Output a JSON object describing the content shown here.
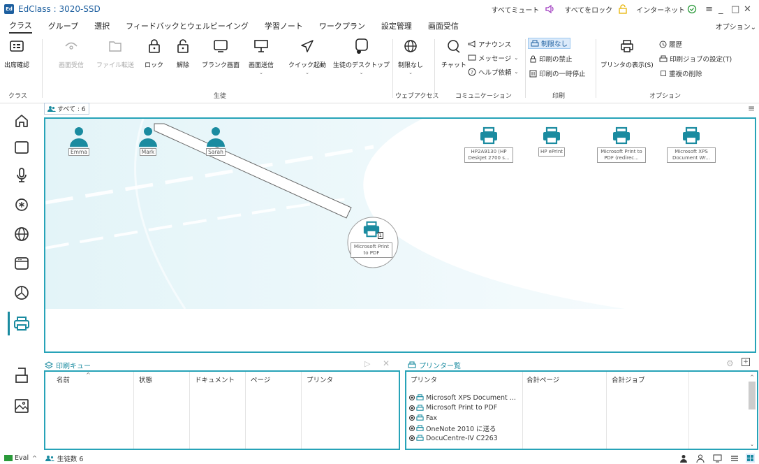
{
  "app": {
    "title": "EdClass : 3020-SSD",
    "logo": "Ed"
  },
  "titlebar": {
    "mute_all": "すべてミュート",
    "lock_all": "すべてをロック",
    "internet": "インターネット",
    "minimize": "_",
    "maximize": "□",
    "close": "✕"
  },
  "menu": {
    "tabs": [
      "クラス",
      "グループ",
      "選択",
      "フィードバックとウェルビーイング",
      "学習ノート",
      "ワークプラン",
      "設定管理",
      "画面受信"
    ],
    "options": "オプション"
  },
  "ribbon": {
    "attendance": "出席確認",
    "screen_receive": "画面受信",
    "file_transfer": "ファイル転送",
    "lock": "ロック",
    "unlock": "解除",
    "blank_screen": "ブランク画面",
    "screen_send": "画面送信",
    "quick_launch": "クイック起動",
    "student_desktop": "生徒のデスクトップ",
    "no_limit_web": "制限なし",
    "chat": "チャット",
    "announce": "アナウンス",
    "message": "メッセージ",
    "help_request": "ヘルプ依頼",
    "print_no_limit": "制限なし",
    "print_prohibit": "印刷の禁止",
    "print_pause": "印刷の一時停止",
    "show_printer": "プリンタの表示(S)",
    "history": "履歴",
    "print_job_settings": "印刷ジョブの設定(T)",
    "remove_duplicates": "重複の削除",
    "groups": {
      "class": "クラス",
      "student": "生徒",
      "web_access": "ウェブアクセス",
      "communication": "コミュニケーション",
      "print": "印刷",
      "options": "オプション"
    }
  },
  "breadcrumb": {
    "label": "すべて : 6"
  },
  "students": [
    {
      "name": "Emma"
    },
    {
      "name": "Mark"
    },
    {
      "name": "Sarah"
    }
  ],
  "printers": [
    {
      "name": "HP2A9130 (HP DeskJet 2700 s..."
    },
    {
      "name": "HP ePrint"
    },
    {
      "name": "Microsoft Print to PDF (redirec..."
    },
    {
      "name": "Microsoft XPS Document Wr..."
    }
  ],
  "selected_printer": {
    "name": "Microsoft Print to PDF",
    "badge": "1"
  },
  "print_queue": {
    "title": "印刷キュー",
    "columns": [
      "名前",
      "状態",
      "ドキュメント",
      "ページ",
      "プリンタ"
    ]
  },
  "printer_list": {
    "title": "プリンター覧",
    "columns": [
      "プリンタ",
      "合計ページ",
      "合計ジョブ"
    ],
    "rows": [
      "Microsoft XPS Document ...",
      "Microsoft Print to PDF",
      "Fax",
      "OneNote 2010 に送る",
      "DocuCentre-IV C2263"
    ]
  },
  "status": {
    "eval": "Eval",
    "student_count": "生徒数 6"
  },
  "colors": {
    "accent": "#27a3b8",
    "brand": "#1d5f9f",
    "highlight": "#dbeafa"
  }
}
